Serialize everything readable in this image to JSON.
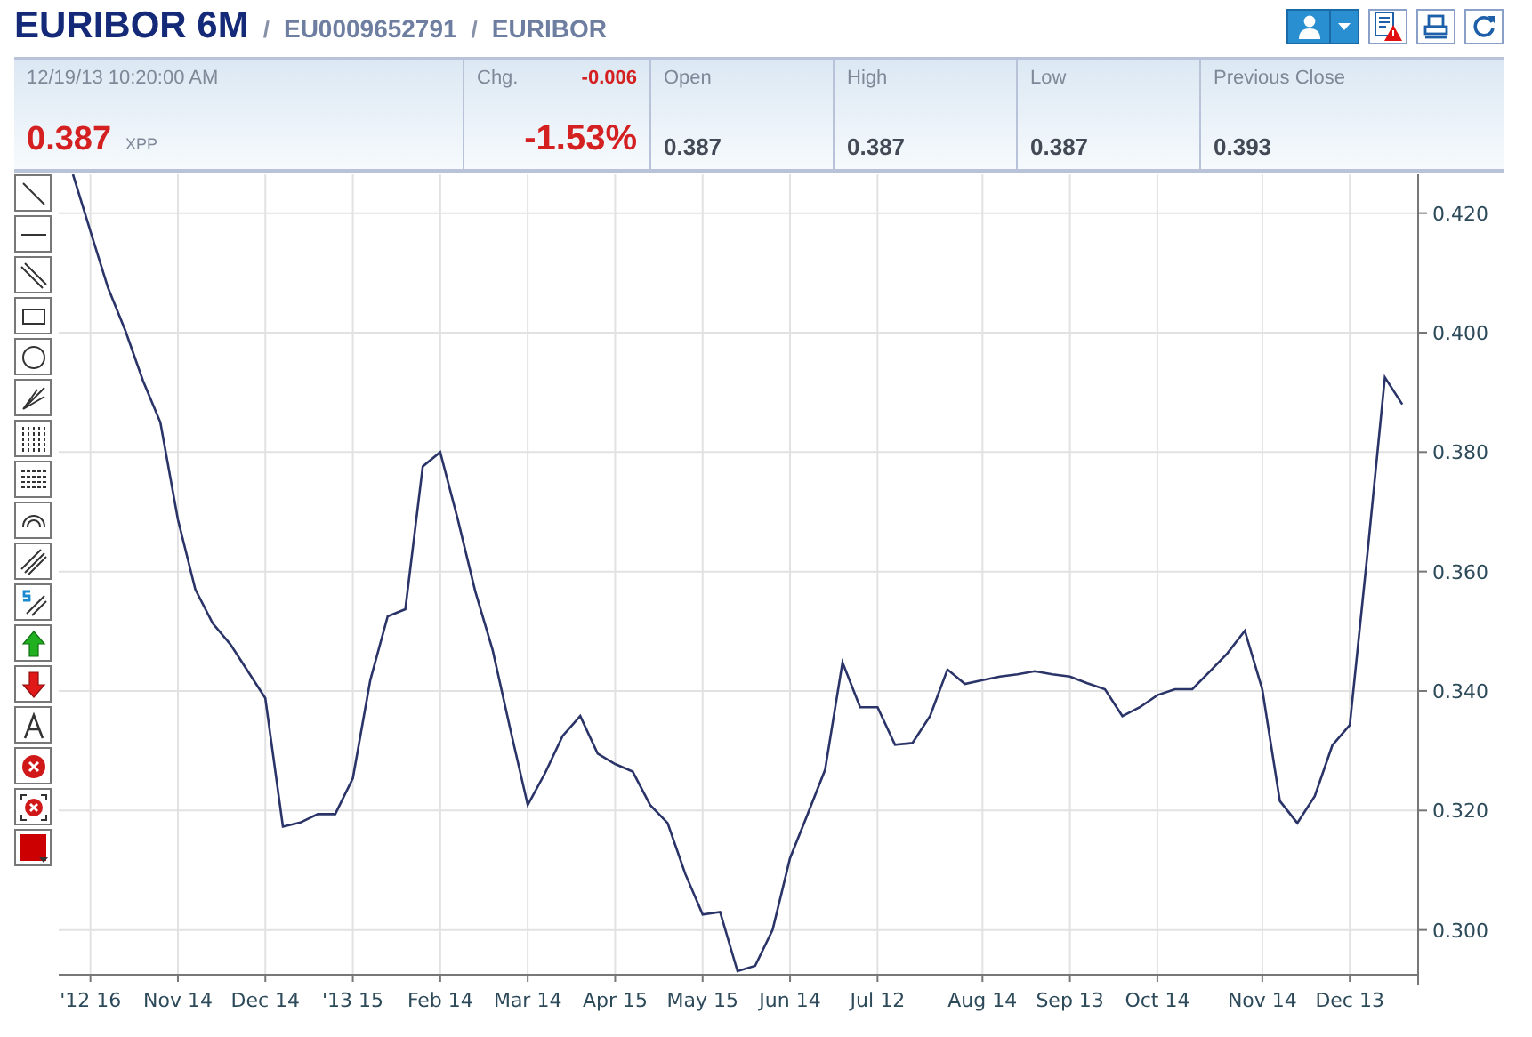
{
  "header": {
    "title": "EURIBOR 6M",
    "isin": "EU0009652791",
    "market": "EURIBOR",
    "separators": [
      "/",
      "/"
    ]
  },
  "quote": {
    "timestamp": "12/19/13  10:20:00 AM",
    "last": "0.387",
    "unit": "XPP",
    "change_label": "Chg.",
    "change": "-0.006",
    "change_pct": "-1.53%",
    "stats": [
      {
        "label": "Open",
        "value": "0.387"
      },
      {
        "label": "High",
        "value": "0.387"
      },
      {
        "label": "Low",
        "value": "0.387"
      },
      {
        "label": "Previous Close",
        "value": "0.393"
      }
    ]
  },
  "chart": {
    "chart_data": {
      "type": "line",
      "grid": true,
      "ylim": [
        0.2925,
        0.4265
      ],
      "categories": [
        null,
        "'12 16",
        null,
        null,
        null,
        null,
        "Nov 14",
        null,
        null,
        null,
        null,
        "Dec 14",
        null,
        null,
        null,
        null,
        "'13 15",
        null,
        null,
        null,
        null,
        "Feb 14",
        null,
        null,
        null,
        null,
        "Mar 14",
        null,
        null,
        null,
        null,
        "Apr 15",
        null,
        null,
        null,
        null,
        "May 15",
        null,
        null,
        null,
        null,
        "Jun 14",
        null,
        null,
        null,
        null,
        "Jul 12",
        null,
        null,
        null,
        null,
        null,
        "Aug 14",
        null,
        null,
        null,
        null,
        "Sep 13",
        null,
        null,
        null,
        null,
        "Oct 14",
        null,
        null,
        null,
        null,
        null,
        "Nov 14",
        null,
        null,
        null,
        null,
        "Dec 13",
        null,
        null,
        null
      ],
      "yticks": [
        {
          "value": 0.3,
          "label": "0.300"
        },
        {
          "value": 0.32,
          "label": "0.320"
        },
        {
          "value": 0.34,
          "label": "0.340"
        },
        {
          "value": 0.36,
          "label": "0.360"
        },
        {
          "value": 0.38,
          "label": "0.380"
        },
        {
          "value": 0.4,
          "label": "0.400"
        },
        {
          "value": 0.42,
          "label": "0.420"
        }
      ],
      "series": [
        {
          "color": "#2b3468",
          "values": [
            0.4265,
            0.417,
            0.4075,
            0.4003,
            0.392,
            0.385,
            0.3687,
            0.357,
            0.3513,
            0.3478,
            0.3433,
            0.3388,
            0.3173,
            0.318,
            0.3194,
            0.3194,
            0.3254,
            0.3418,
            0.3525,
            0.3537,
            0.3776,
            0.38,
            0.3687,
            0.3567,
            0.3468,
            0.3336,
            0.3209,
            0.3263,
            0.3325,
            0.3358,
            0.3295,
            0.3278,
            0.3265,
            0.3209,
            0.3179,
            0.3094,
            0.3026,
            0.303,
            0.2931,
            0.294,
            0.3,
            0.312,
            0.3194,
            0.3268,
            0.3448,
            0.3373,
            0.3373,
            0.331,
            0.3313,
            0.3358,
            0.3436,
            0.3412,
            0.3418,
            0.3424,
            0.3428,
            0.3433,
            0.3428,
            0.3424,
            0.3413,
            0.3403,
            0.3358,
            0.3373,
            0.3393,
            0.3403,
            0.3403,
            0.3433,
            0.3463,
            0.3501,
            0.3403,
            0.3216,
            0.3179,
            0.3224,
            0.3309,
            0.3343,
            0.3627,
            0.3925,
            0.388
          ]
        }
      ]
    }
  }
}
